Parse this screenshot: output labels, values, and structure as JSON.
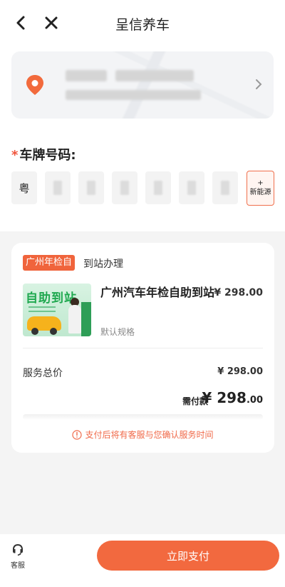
{
  "header": {
    "title": "呈信养车"
  },
  "plate": {
    "label": "车牌号码:",
    "required_mark": "*",
    "province": "粤",
    "new_energy_plus": "+",
    "new_energy_label": "新能源"
  },
  "order": {
    "tag": "广州年检自",
    "service_mode": "到站办理",
    "thumbnail_title": "自助到站",
    "product_name": "广州汽车年检自助到站",
    "product_spec": "默认规格",
    "product_price": "¥ 298.00",
    "total_label": "服务总价",
    "total_value": "¥ 298.00",
    "pay_label": "需付款",
    "pay_value_main": "¥ 298",
    "pay_value_decimal": ".00",
    "note": "支付后将有客服与您确认服务时间"
  },
  "footer": {
    "service_label": "客服",
    "pay_button": "立即支付"
  },
  "colors": {
    "accent": "#f2693f",
    "tag": "#f0643c",
    "pin": "#f26a3c"
  }
}
